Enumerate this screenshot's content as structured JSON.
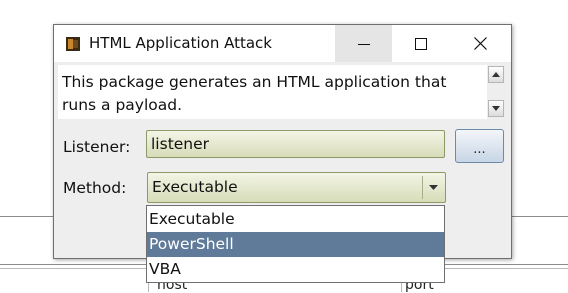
{
  "window": {
    "title": "HTML Application Attack",
    "description": "This package generates an HTML application that runs a payload."
  },
  "form": {
    "listener_label": "Listener:",
    "listener_value": "listener",
    "browse_label": "...",
    "method_label": "Method:",
    "method_value": "Executable",
    "method_options": [
      "Executable",
      "PowerShell",
      "VBA"
    ],
    "method_highlighted": "PowerShell"
  },
  "background": {
    "column_headers": [
      "host",
      "port"
    ]
  },
  "colors": {
    "field_bg": "#e4e7cc",
    "selection": "#5f7b99"
  }
}
